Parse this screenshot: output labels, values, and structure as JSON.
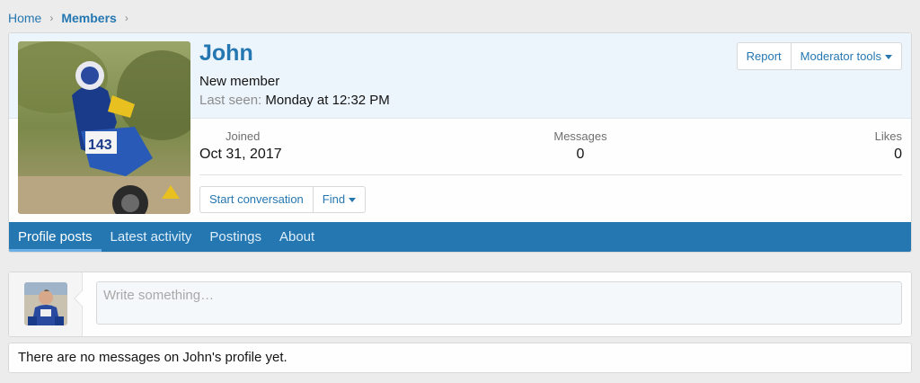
{
  "breadcrumb": [
    {
      "label": "Home"
    },
    {
      "label": "Members"
    }
  ],
  "profile": {
    "username": "John",
    "user_title": "New member",
    "last_seen_label": "Last seen:",
    "last_seen_value": "Monday at 12:32 PM",
    "header_buttons": {
      "report": "Report",
      "moderator_tools": "Moderator tools"
    },
    "stats": {
      "joined": {
        "label": "Joined",
        "value": "Oct 31, 2017"
      },
      "messages": {
        "label": "Messages",
        "value": "0"
      },
      "likes": {
        "label": "Likes",
        "value": "0"
      }
    },
    "actions": {
      "start_conversation": "Start conversation",
      "find": "Find"
    }
  },
  "tabs": [
    {
      "label": "Profile posts",
      "active": true
    },
    {
      "label": "Latest activity",
      "active": false
    },
    {
      "label": "Postings",
      "active": false
    },
    {
      "label": "About",
      "active": false
    }
  ],
  "composer": {
    "placeholder": "Write something…"
  },
  "empty_message": "There are no messages on John's profile yet.",
  "colors": {
    "accent": "#2577b1",
    "header_bg": "#edf5fc",
    "page_bg": "#ececec"
  }
}
